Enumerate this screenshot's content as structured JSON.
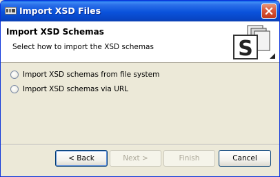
{
  "window": {
    "title": "Import XSD Files",
    "title_icon": "app-icon",
    "close_icon": "close-icon"
  },
  "header": {
    "title": "Import XSD Schemas",
    "description": "Select how to import the XSD schemas",
    "banner_icon": "schema-files-icon",
    "banner_text": "S"
  },
  "options": [
    {
      "label": "Import XSD schemas from file system",
      "selected": false
    },
    {
      "label": "Import XSD schemas via URL",
      "selected": false
    }
  ],
  "buttons": {
    "back": "< Back",
    "next": "Next >",
    "finish": "Finish",
    "cancel": "Cancel"
  },
  "colors": {
    "titlebar": "#0a52db",
    "dialog_bg": "#ece9d8",
    "close_button": "#d8563a"
  }
}
